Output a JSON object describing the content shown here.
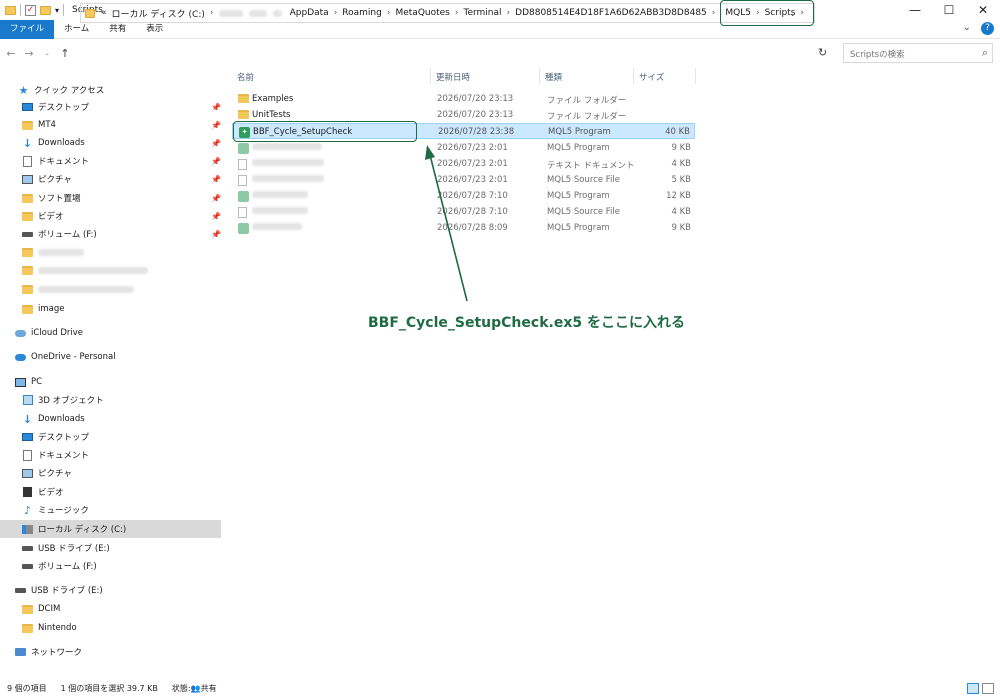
{
  "window": {
    "title": "Scripts"
  },
  "ribbon": {
    "tabs": [
      "ファイル",
      "ホーム",
      "共有",
      "表示"
    ]
  },
  "address": {
    "prefix": "«",
    "drive": "ローカル ディスク (C:)",
    "crumbs": [
      "AppData",
      "Roaming",
      "MetaQuotes",
      "Terminal",
      "DD8808514E4D18F1A6D62ABB3D8D8485"
    ],
    "highlight_crumbs": [
      "MQL5",
      "Scripts"
    ],
    "search_placeholder": "Scriptsの検索"
  },
  "sidebar": {
    "quick_access": "クイック アクセス",
    "quick_items": [
      "デスクトップ",
      "MT4",
      "Downloads",
      "ドキュメント",
      "ピクチャ",
      "ソフト置場",
      "ビデオ",
      "ボリューム (F:)"
    ],
    "image_folder": "image",
    "icloud": "iCloud Drive",
    "onedrive": "OneDrive - Personal",
    "pc": "PC",
    "pc_items": [
      "3D オブジェクト",
      "Downloads",
      "デスクトップ",
      "ドキュメント",
      "ピクチャ",
      "ビデオ",
      "ミュージック",
      "ローカル ディスク (C:)",
      "USB ドライブ (E:)",
      "ボリューム (F:)"
    ],
    "usb": "USB ドライブ (E:)",
    "usb_items": [
      "DCIM",
      "Nintendo"
    ],
    "network": "ネットワーク"
  },
  "columns": {
    "name": "名前",
    "date": "更新日時",
    "type": "種類",
    "size": "サイズ"
  },
  "files": [
    {
      "name": "Examples",
      "date": "2026/07/20 23:13",
      "type": "ファイル フォルダー",
      "size": "",
      "icon": "folder-icon"
    },
    {
      "name": "UnitTests",
      "date": "2026/07/20 23:13",
      "type": "ファイル フォルダー",
      "size": "",
      "icon": "folder-icon"
    },
    {
      "name": "BBF_Cycle_SetupCheck",
      "date": "2026/07/28 23:38",
      "type": "MQL5 Program",
      "size": "40 KB",
      "icon": "mql5-program-icon"
    },
    {
      "name": "",
      "date": "2026/07/23 2:01",
      "type": "MQL5 Program",
      "size": "9 KB",
      "icon": "mql5-program-icon"
    },
    {
      "name": "",
      "date": "2026/07/23 2:01",
      "type": "テキスト ドキュメント",
      "size": "4 KB",
      "icon": "text-document-icon"
    },
    {
      "name": "",
      "date": "2026/07/23 2:01",
      "type": "MQL5 Source File",
      "size": "5 KB",
      "icon": "mql5-source-icon"
    },
    {
      "name": "",
      "date": "2026/07/28 7:10",
      "type": "MQL5 Program",
      "size": "12 KB",
      "icon": "mql5-program-icon"
    },
    {
      "name": "",
      "date": "2026/07/28 7:10",
      "type": "MQL5 Source File",
      "size": "4 KB",
      "icon": "mql5-source-icon"
    },
    {
      "name": "",
      "date": "2026/07/28 8:09",
      "type": "MQL5 Program",
      "size": "9 KB",
      "icon": "mql5-program-icon"
    }
  ],
  "annotation": {
    "text": "BBF_Cycle_SetupCheck.ex5 をここに入れる",
    "color": "#1f6b44"
  },
  "status": {
    "count": "9 個の項目",
    "selected": "1 個の項目を選択 39.7 KB",
    "state": "状態:",
    "shared": "共有"
  }
}
